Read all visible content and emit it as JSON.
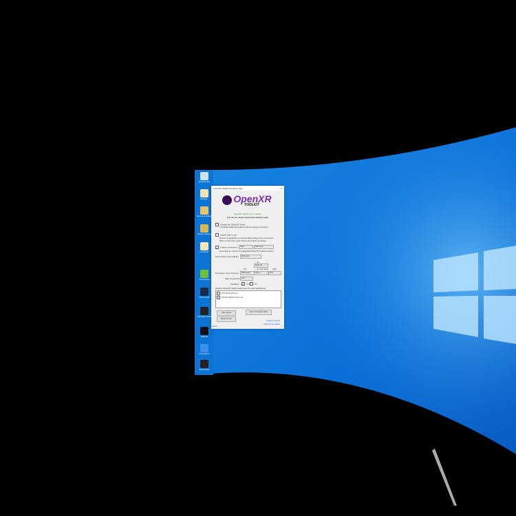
{
  "desktop_icons": [
    {
      "label": "Recycle Bin",
      "color": "#cfe2f2"
    },
    {
      "label": "Getting...",
      "color": "#f3e3b0"
    },
    {
      "label": "Tools and Utilities",
      "color": "#e8c36b"
    },
    {
      "label": "Steam Games",
      "color": "#d9b55a"
    },
    {
      "label": "Computer",
      "color": "#f4e6b8"
    },
    {
      "label": "Companion",
      "color": "#6fbf3a"
    },
    {
      "label": "DCS World",
      "color": "#1b2a4a"
    },
    {
      "label": "OpenXR Toolkit",
      "color": "#222"
    },
    {
      "label": "Settings",
      "color": "#111"
    },
    {
      "label": "Companion",
      "color": "#3c8ee8"
    },
    {
      "label": "Screenshot",
      "color": "#2a1f1f"
    }
  ],
  "window": {
    "title": "OpenXR Toolkit Companion app",
    "logo": "OpenXR",
    "logo_sub": "TOOLKIT",
    "status": "OpenXR Toolkit 1.0.x is active",
    "hint": "You do not need to keep this window open",
    "disable_label": "Disable the OpenXR Toolkit",
    "disable_desc": "Completely disable the software without needing to uninstall it",
    "safe_label": "Enable safe mode",
    "safe_desc1": "Recover an application by ignoring all the settings upon next startup.",
    "safe_desc2": "When in safe mode, press Ctrl+F1+F2 to delete all settings",
    "screenshot_label": "Enable screenshot",
    "screenshot_format": "PNG",
    "screenshot_eyes": "Both eyes",
    "screenshot_path": "Screenshots are stored in %LocalAppData%\\OpenXR Toolkit\\screenshots",
    "eyes_visibility_label": "Screenshot eyes visibility",
    "eyes_visibility_value": "Both eyes",
    "up_label": "up",
    "up_value": "Page Up",
    "left_label": "left",
    "updown_label": "up and down",
    "right_label": "right",
    "hotkeys_label": "On-screen menu hotkeys",
    "left_value": "Backspace",
    "updown_value": "Minus",
    "right_value": "Plus",
    "take_screenshot_label": "Take screenshot",
    "take_screenshot_value": "F12",
    "modifiers_label": "Modifiers",
    "mod_ctrl": "Ctrl",
    "mod_alt": "Alt",
    "apps_label": "Disable OpenXR Toolkit selectively for each application:",
    "apps": [
      "DCS World (DCS.exe)",
      "FS2020 (FlightSimulator.exe)"
    ],
    "open_log": "Open log file",
    "open_screens": "Open screenshot folder",
    "report": "Report issues",
    "licenses": "3rd Party Licenses",
    "updates": "Check for new updates",
    "about": "About"
  }
}
